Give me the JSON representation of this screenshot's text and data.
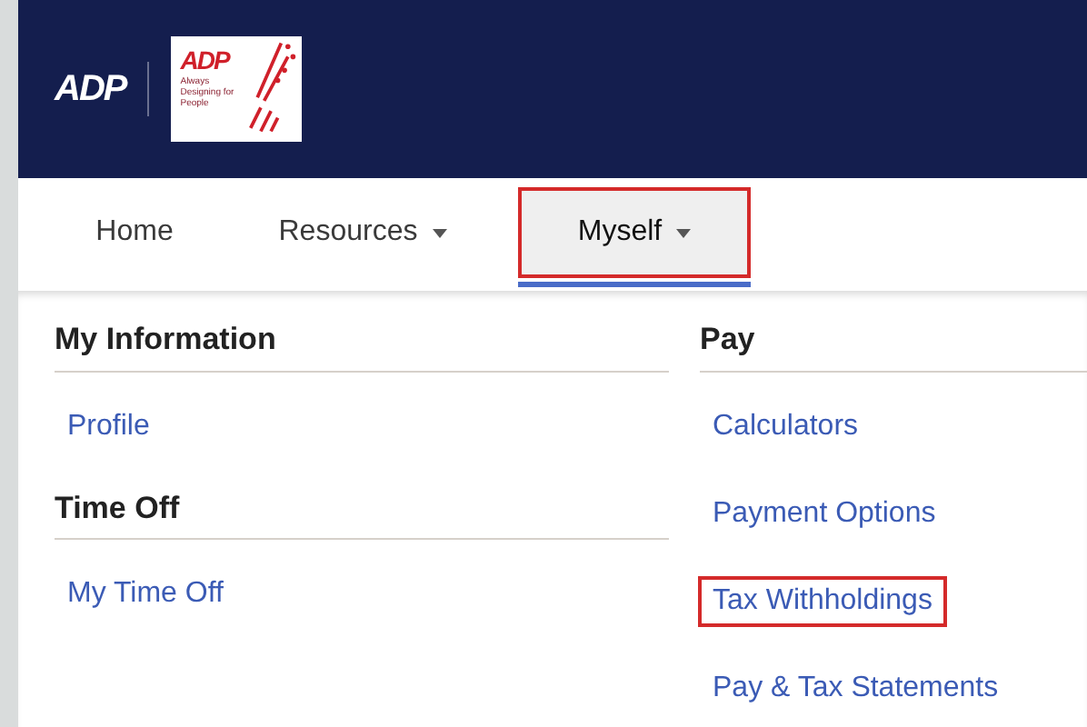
{
  "header": {
    "logo_text": "ADP",
    "badge": {
      "logo_text": "ADP",
      "tagline": "Always Designing for People"
    }
  },
  "nav": [
    {
      "label": "Home",
      "has_menu": false,
      "selected": false,
      "highlighted": false
    },
    {
      "label": "Resources",
      "has_menu": true,
      "selected": false,
      "highlighted": false
    },
    {
      "label": "Myself",
      "has_menu": true,
      "selected": true,
      "highlighted": true
    }
  ],
  "menu": {
    "columns": [
      {
        "sections": [
          {
            "heading": "My Information",
            "links": [
              {
                "label": "Profile",
                "highlighted": false
              }
            ]
          },
          {
            "heading": "Time Off",
            "links": [
              {
                "label": "My Time Off",
                "highlighted": false
              }
            ]
          }
        ]
      },
      {
        "sections": [
          {
            "heading": "Pay",
            "links": [
              {
                "label": "Calculators",
                "highlighted": false
              },
              {
                "label": "Payment Options",
                "highlighted": false
              },
              {
                "label": "Tax Withholdings",
                "highlighted": true
              },
              {
                "label": "Pay & Tax Statements",
                "highlighted": false
              }
            ]
          }
        ]
      }
    ]
  }
}
